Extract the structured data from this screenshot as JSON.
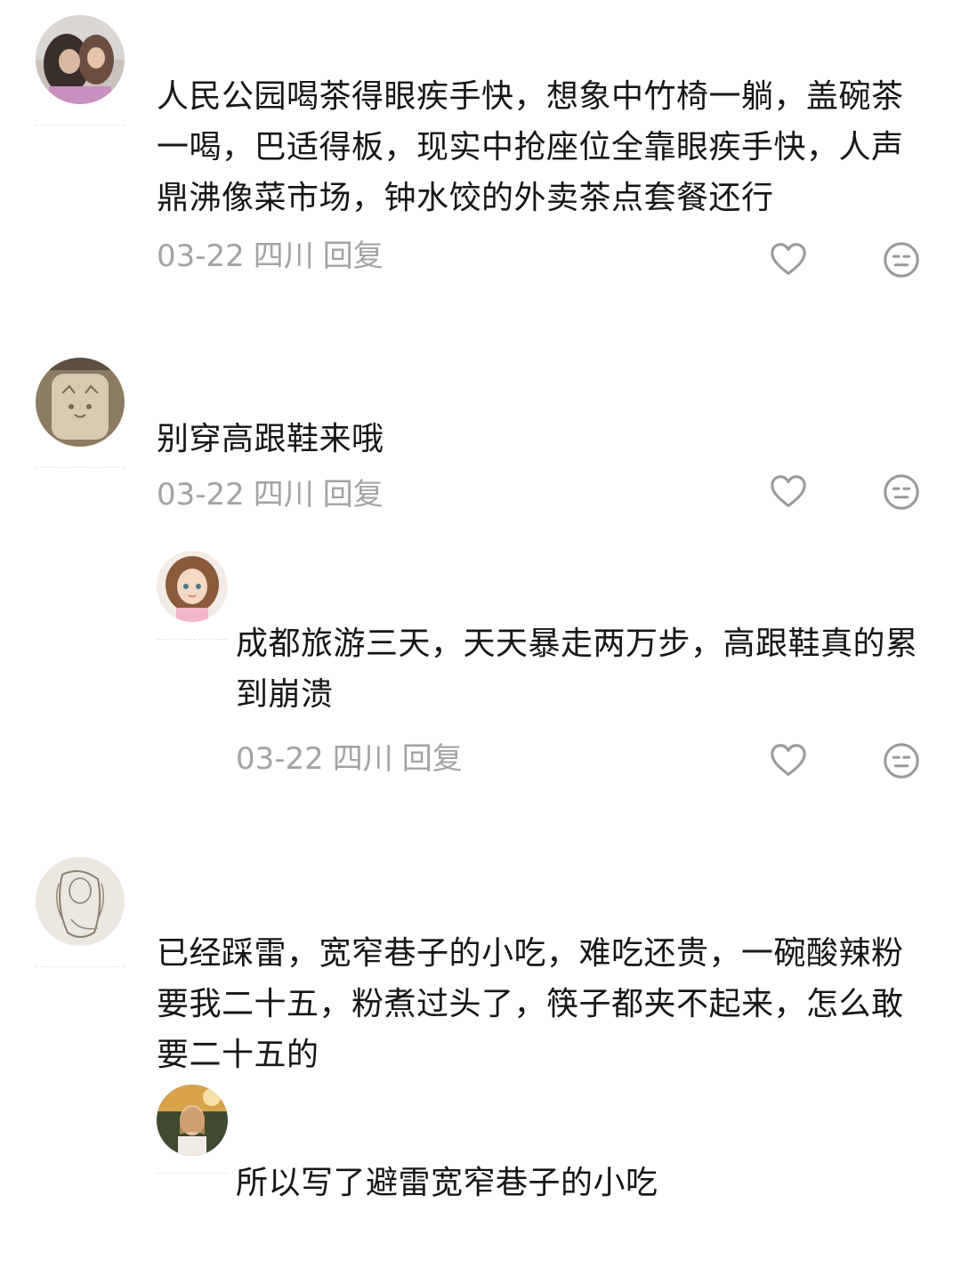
{
  "comments": [
    {
      "text": "人民公园喝茶得眼疾手快，想象中竹椅一躺，盖碗茶一喝，巴适得板，现实中抢座位全靠眼疾手快，人声鼎沸像菜市场，钟水饺的外卖茶点套餐还行",
      "date": "03-22",
      "location": "四川",
      "reply_label": "回复",
      "like_icon": "heart-outline-icon",
      "dislike_icon": "neutral-face-icon"
    },
    {
      "text": "别穿高跟鞋来哦",
      "date": "03-22",
      "location": "四川",
      "reply_label": "回复",
      "like_icon": "heart-outline-icon",
      "dislike_icon": "neutral-face-icon",
      "replies": [
        {
          "text": "成都旅游三天，天天暴走两万步，高跟鞋真的累到崩溃",
          "date": "03-22",
          "location": "四川",
          "reply_label": "回复",
          "like_icon": "heart-outline-icon",
          "dislike_icon": "neutral-face-icon"
        }
      ]
    },
    {
      "text": "已经踩雷，宽窄巷子的小吃，难吃还贵，一碗酸辣粉要我二十五，粉煮过头了，筷子都夹不起来，怎么敢要二十五的",
      "replies": [
        {
          "text": "所以写了避雷宽窄巷子的小吃"
        }
      ]
    }
  ],
  "colors": {
    "text": "#161616",
    "meta": "#a3a3a3",
    "icon": "#9a9a9a"
  }
}
